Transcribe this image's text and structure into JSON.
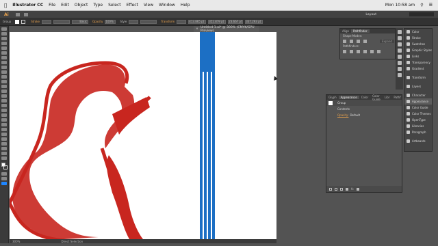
{
  "menubar": {
    "app": "Illustrator CC",
    "items": [
      "File",
      "Edit",
      "Object",
      "Type",
      "Select",
      "Effect",
      "View",
      "Window",
      "Help"
    ],
    "clock": "Mon 10:58 am"
  },
  "appbar": {
    "logo": "Ai",
    "workspace": "Layout"
  },
  "controlbar": {
    "selection": "Group",
    "stroke_label": "Stroke",
    "style_label": "Basic",
    "opacity_label": "Opacity",
    "opacity_value": "100%",
    "style2_label": "Style",
    "transform_label": "Transform",
    "x": "413.865 pt",
    "y": "352.879 pt",
    "w": "23.667 pt",
    "h": "337.293 pt"
  },
  "document": {
    "tab": "Untitled-1.ai* @ 300% (CMYK/GPU Preview)"
  },
  "align_panel": {
    "tabs": [
      "Align",
      "Pathfinder"
    ],
    "shape_modes": "Shape Modes:",
    "pathfinders": "Pathfinders:",
    "expand": "Expand"
  },
  "appearance_panel": {
    "tabs": [
      "Glyph",
      "Appearance",
      "Color",
      "Color Guide",
      "Libr",
      "Pathf"
    ],
    "group": "Group",
    "contents": "Contents",
    "opacity_label": "Opacity:",
    "opacity_value": "Default"
  },
  "dock": {
    "items": [
      "Color",
      "Stroke",
      "Swatches",
      "Graphic Styles",
      "Links",
      "Transparency",
      "Gradient",
      "Transform",
      "Layers",
      "Character",
      "Appearance",
      "Color Guide",
      "Color Themes",
      "OpenType",
      "Libraries",
      "Paragraph",
      "Artboards"
    ]
  },
  "statusbar": {
    "zoom": "300%",
    "tool": "Direct Selection"
  },
  "colors": {
    "violin": "#c8261f",
    "lines": "#1c6fc4"
  }
}
